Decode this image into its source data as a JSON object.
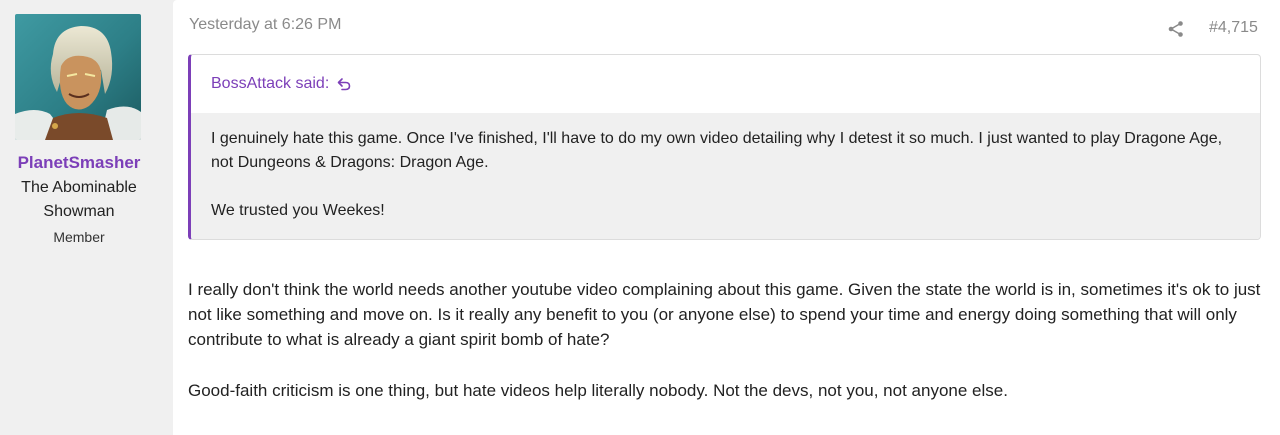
{
  "user": {
    "name": "PlanetSmasher",
    "title": "The Abominable Showman",
    "role": "Member"
  },
  "post": {
    "timestamp": "Yesterday at 6:26 PM",
    "number": "#4,715",
    "share_icon": "share-icon",
    "quote": {
      "author_said": "BossAttack said:",
      "jump_icon": "jump-to-quote-icon",
      "paragraphs": [
        "I genuinely hate this game. Once I've finished, I'll have to do my own video detailing why I detest it so much. I just wanted to play Dragone Age, not Dungeons & Dragons: Dragon Age.",
        "We trusted you Weekes!"
      ]
    },
    "paragraphs": [
      "I really don't think the world needs another youtube video complaining about this game. Given the state the world is in, sometimes it's ok to just not like something and move on. Is it really any benefit to you (or anyone else) to spend your time and energy doing something that will only contribute to what is already a giant spirit bomb of hate?",
      "Good-faith criticism is one thing, but hate videos help literally nobody. Not the devs, not you, not anyone else."
    ]
  },
  "colors": {
    "accent": "#7c3fb8",
    "muted": "#8a8a8a",
    "quote_bg": "#f0f0f0",
    "page_bg": "#f0f0f0"
  }
}
